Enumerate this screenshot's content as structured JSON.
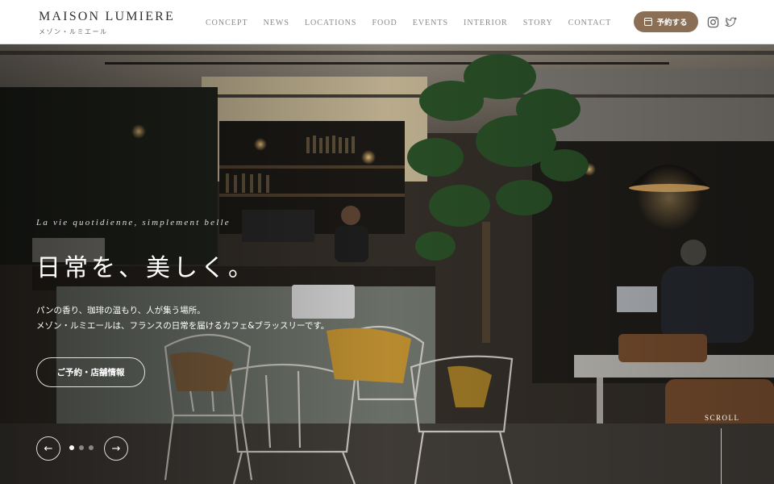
{
  "brand": {
    "name": "MAISON LUMIERE",
    "sub": "メゾン・ルミエール"
  },
  "nav": {
    "items": [
      "CONCEPT",
      "NEWS",
      "LOCATIONS",
      "FOOD",
      "EVENTS",
      "INTERIOR",
      "STORY",
      "CONTACT"
    ]
  },
  "header": {
    "reserve_label": "予約する"
  },
  "icons": {
    "reserve": "calendar-icon",
    "instagram": "instagram-icon",
    "twitter": "twitter-icon",
    "prev": "arrow-left-icon",
    "next": "arrow-right-icon"
  },
  "hero": {
    "tagline": "La vie quotidienne, simplement belle",
    "headline": "日常を、美しく。",
    "desc_line1": "パンの香り、珈琲の温もり、人が集う場所。",
    "desc_line2": "メゾン・ルミエールは、フランスの日常を届けるカフェ&ブラッスリーです。",
    "cta_label": "ご予約・店舗情報",
    "prev_symbol": "←",
    "next_symbol": "→",
    "slide_count": 3,
    "active_slide": 1,
    "scroll_label": "SCROLL"
  },
  "colors": {
    "accent": "#8a6f55",
    "header_bg": "#ffffff",
    "nav_text": "#8a8a8a"
  }
}
